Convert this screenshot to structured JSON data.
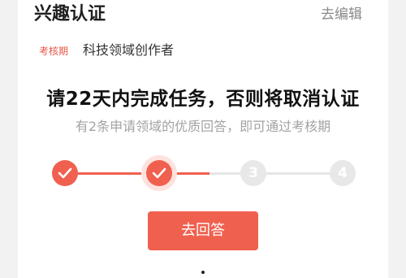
{
  "header": {
    "title": "兴趣认证",
    "edit_label": "去编辑"
  },
  "period": {
    "tag": "考核期",
    "domain": "科技领域创作者"
  },
  "task": {
    "headline": "请22天内完成任务，否则将取消认证",
    "subline": "有2条申请领域的优质回答，即可通过考核期"
  },
  "progress": {
    "steps": [
      {
        "label": "",
        "state": "done"
      },
      {
        "label": "",
        "state": "current"
      },
      {
        "label": "3",
        "state": "todo"
      },
      {
        "label": "4",
        "state": "todo"
      }
    ],
    "completed": 2,
    "total": 4
  },
  "actions": {
    "answer_label": "去回答"
  },
  "colors": {
    "accent": "#f0604f",
    "inactive": "#e8e8e8"
  }
}
